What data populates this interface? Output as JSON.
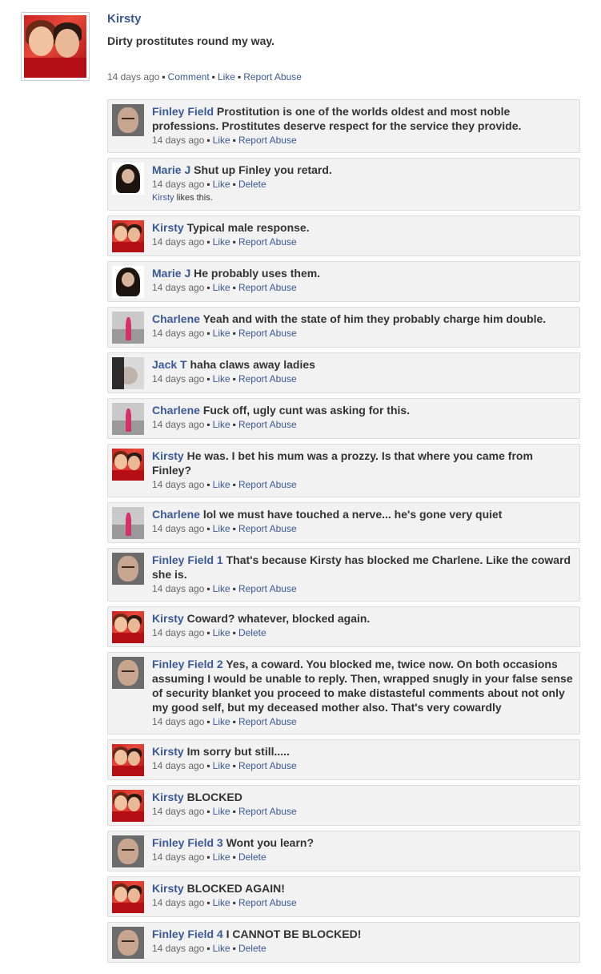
{
  "post": {
    "author": "Kirsty",
    "text": "Dirty prostitutes round my way.",
    "time": "14 days ago",
    "actions": [
      "Comment",
      "Like",
      "Report Abuse"
    ],
    "avatar_icon": "profile-photo-kirsty"
  },
  "colors": {
    "link": "#3b5998",
    "comment_bg": "#f2f2f2",
    "text": "#333333",
    "meta": "#666666"
  },
  "comments": [
    {
      "author": "Finley Field",
      "text": "Prostitution is one of the worlds oldest and most noble professions. Prostitutes deserve respect for the service they provide.",
      "time": "14 days ago",
      "actions": [
        "Like",
        "Report Abuse"
      ],
      "avatar": "finley"
    },
    {
      "author": "Marie J",
      "text": "Shut up Finley you retard.",
      "time": "14 days ago",
      "actions": [
        "Like",
        "Delete"
      ],
      "avatar": "marie",
      "likes": {
        "name": "Kirsty",
        "text": "likes this."
      }
    },
    {
      "author": "Kirsty",
      "text": "Typical male response.",
      "time": "14 days ago",
      "actions": [
        "Like",
        "Report Abuse"
      ],
      "avatar": "kirsty"
    },
    {
      "author": "Marie J",
      "text": "He probably uses them.",
      "time": "14 days ago",
      "actions": [
        "Like",
        "Report Abuse"
      ],
      "avatar": "marie"
    },
    {
      "author": "Charlene",
      "text": "Yeah and with the state of him they probably charge him double.",
      "time": "14 days ago",
      "actions": [
        "Like",
        "Report Abuse"
      ],
      "avatar": "charlene"
    },
    {
      "author": "Jack T",
      "text": "haha claws away ladies",
      "time": "14 days ago",
      "actions": [
        "Like",
        "Report Abuse"
      ],
      "avatar": "jack"
    },
    {
      "author": "Charlene",
      "text": "Fuck off, ugly cunt was asking for this.",
      "time": "14 days ago",
      "actions": [
        "Like",
        "Report Abuse"
      ],
      "avatar": "charlene"
    },
    {
      "author": "Kirsty",
      "text": "He was. I bet his mum was a prozzy. Is that where you came from Finley?",
      "time": "14 days ago",
      "actions": [
        "Like",
        "Report Abuse"
      ],
      "avatar": "kirsty"
    },
    {
      "author": "Charlene",
      "text": "lol we must have touched a nerve... he's gone very quiet",
      "time": "14 days ago",
      "actions": [
        "Like",
        "Report Abuse"
      ],
      "avatar": "charlene"
    },
    {
      "author": "Finley Field 1",
      "text": "That's because Kirsty has blocked me Charlene. Like the coward she is.",
      "time": "14 days ago",
      "actions": [
        "Like",
        "Report Abuse"
      ],
      "avatar": "finley"
    },
    {
      "author": "Kirsty",
      "text": "Coward? whatever, blocked again.",
      "time": "14 days ago",
      "actions": [
        "Like",
        "Delete"
      ],
      "avatar": "kirsty"
    },
    {
      "author": "Finley Field 2",
      "text": "Yes, a coward. You blocked me, twice now. On both occasions assuming I would be unable to reply. Then, wrapped snugly in your false sense of security blanket you proceed to make distasteful comments about not only my good self, but my deceased mother also. That's very cowardly",
      "time": "14 days ago",
      "actions": [
        "Like",
        "Report Abuse"
      ],
      "avatar": "finley"
    },
    {
      "author": "Kirsty",
      "text": "Im sorry but still.....",
      "time": "14 days ago",
      "actions": [
        "Like",
        "Report Abuse"
      ],
      "avatar": "kirsty"
    },
    {
      "author": "Kirsty",
      "text": "BLOCKED",
      "time": "14 days ago",
      "actions": [
        "Like",
        "Report Abuse"
      ],
      "avatar": "kirsty"
    },
    {
      "author": "Finley Field 3",
      "text": "Wont you learn?",
      "time": "14 days ago",
      "actions": [
        "Like",
        "Delete"
      ],
      "avatar": "finley"
    },
    {
      "author": "Kirsty",
      "text": "BLOCKED AGAIN!",
      "time": "14 days ago",
      "actions": [
        "Like",
        "Report Abuse"
      ],
      "avatar": "kirsty"
    },
    {
      "author": "Finley Field 4",
      "text": "I CANNOT BE BLOCKED!",
      "time": "14 days ago",
      "actions": [
        "Like",
        "Delete"
      ],
      "avatar": "finley"
    }
  ]
}
